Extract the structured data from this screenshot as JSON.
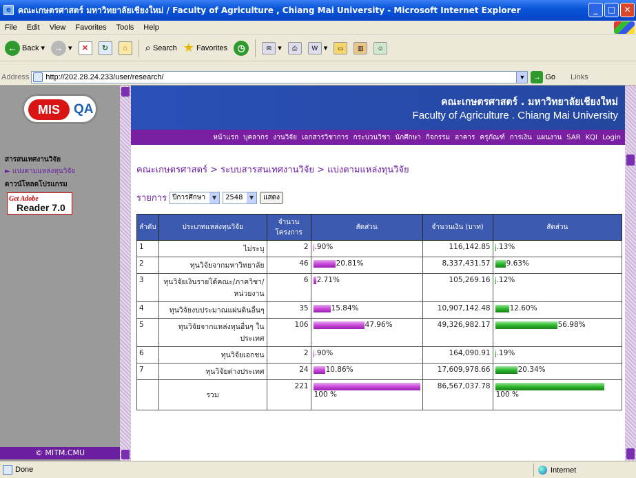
{
  "window": {
    "title": "คณะเกษตรศาสตร์ มหาวิทยาลัยเชียงใหม่ / Faculty of Agriculture , Chiang Mai University   - Microsoft Internet Explorer"
  },
  "menu": [
    "File",
    "Edit",
    "View",
    "Favorites",
    "Tools",
    "Help"
  ],
  "toolbar": {
    "back": "Back",
    "search": "Search",
    "favorites": "Favorites"
  },
  "address": {
    "label": "Address",
    "url": "http://202.28.24.233/user/research/",
    "go": "Go",
    "links": "Links"
  },
  "sidebar": {
    "logo_mis": "MIS",
    "logo_qa": "QA",
    "section1": "สารสนเทศงานวิจัย",
    "section1_item": "► แบ่งตามแหล่งทุนวิจัย",
    "section2": "ดาวน์โหลดโปรแกรม",
    "adobe_top": "Get Adobe",
    "adobe_bottom": "Reader 7.0",
    "footer": "© MITM.CMU"
  },
  "banner": {
    "thai": "คณะเกษตรศาสตร์ . มหาวิทยาลัยเชียงใหม่",
    "english": "Faculty of Agriculture . Chiang Mai University"
  },
  "nav": [
    "หน้าแรก",
    "บุคลากร",
    "งานวิจัย",
    "เอกสารวิชาการ",
    "กระบวนวิชา",
    "นักศึกษา",
    "กิจกรรม",
    "อาคาร",
    "ครุภัณฑ์",
    "การเงิน",
    "แผนงาน",
    "SAR",
    "KQI",
    "Login"
  ],
  "breadcrumb": "คณะเกษตรศาสตร์ > ระบบสารสนเทศงานวิจัย > แบ่งตามแหล่งทุนวิจัย",
  "filter": {
    "label": "รายการ",
    "type_value": "ปีการศึกษา",
    "year_value": "2548",
    "button": "แสดง"
  },
  "table": {
    "headers": [
      "ลำดับ",
      "ประเภทแหล่งทุนวิจัย",
      "จำนวนโครงการ",
      "สัดส่วน",
      "จำนวนเงิน (บาท)",
      "สัดส่วน"
    ],
    "rows": [
      {
        "idx": "1",
        "name": "ไม่ระบุ",
        "count": "2",
        "pct": ".90%",
        "pct_value": 0.9,
        "amount": "116,142.85",
        "amt_pct": ".13%",
        "amt_pct_value": 0.13
      },
      {
        "idx": "2",
        "name": "ทุนวิจัยจากมหาวิทยาลัย",
        "count": "46",
        "pct": "20.81%",
        "pct_value": 20.81,
        "amount": "8,337,431.57",
        "amt_pct": "9.63%",
        "amt_pct_value": 9.63
      },
      {
        "idx": "3",
        "name": "ทุนวิจัยเงินรายได้คณะ/ภาควิชา/หน่วยงาน",
        "count": "6",
        "pct": "2.71%",
        "pct_value": 2.71,
        "amount": "105,269.16",
        "amt_pct": ".12%",
        "amt_pct_value": 0.12
      },
      {
        "idx": "4",
        "name": "ทุนวิจัยงบประมาณแผ่นดินอื่นๆ",
        "count": "35",
        "pct": "15.84%",
        "pct_value": 15.84,
        "amount": "10,907,142.48",
        "amt_pct": "12.60%",
        "amt_pct_value": 12.6
      },
      {
        "idx": "5",
        "name": "ทุนวิจัยจากแหล่งทุนอื่นๆ ในประเทศ",
        "count": "106",
        "pct": "47.96%",
        "pct_value": 47.96,
        "amount": "49,326,982.17",
        "amt_pct": "56.98%",
        "amt_pct_value": 56.98
      },
      {
        "idx": "6",
        "name": "ทุนวิจัยเอกชน",
        "count": "2",
        "pct": ".90%",
        "pct_value": 0.9,
        "amount": "164,090.91",
        "amt_pct": ".19%",
        "amt_pct_value": 0.19
      },
      {
        "idx": "7",
        "name": "ทุนวิจัยต่างประเทศ",
        "count": "24",
        "pct": "10.86%",
        "pct_value": 10.86,
        "amount": "17,609,978.66",
        "amt_pct": "20.34%",
        "amt_pct_value": 20.34
      }
    ],
    "total": {
      "label": "รวม",
      "count": "221",
      "pct": "100 %",
      "pct_value": 100,
      "amount": "86,567,037.78",
      "amt_pct": "100 %",
      "amt_pct_value": 100
    }
  },
  "status": {
    "left": "Done",
    "zone": "Internet"
  }
}
